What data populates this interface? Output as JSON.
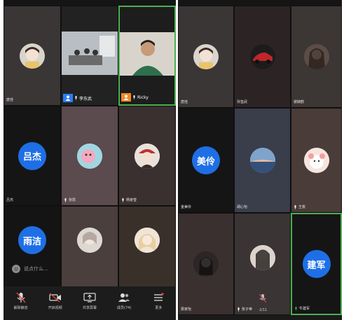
{
  "left_screen": {
    "participants": [
      {
        "name": "唐佳",
        "kind": "photo",
        "bg": "#3a3636",
        "avatar_bg": "#d9d4cc"
      },
      {
        "name": "李东武",
        "kind": "video-host",
        "bg": "#222222",
        "badge_color": "#2d7cf6"
      },
      {
        "name": "Ricky",
        "kind": "video-cohost",
        "bg": "#1d1d1d",
        "badge_color": "#f08a24"
      },
      {
        "name": "吕杰",
        "kind": "text",
        "avatar_text": "吕杰",
        "bg": "#151515"
      },
      {
        "name": "张凯",
        "kind": "photo",
        "bg": "#5b4a4e",
        "avatar_bg": "#e7c7cf"
      },
      {
        "name": "杨家莹",
        "kind": "photo",
        "bg": "#3a3030",
        "avatar_bg": "#d9cfc8"
      },
      {
        "name": "",
        "kind": "text",
        "avatar_text": "雨洁",
        "bg": "#141414"
      },
      {
        "name": "",
        "kind": "photo",
        "bg": "#4a3f3d",
        "avatar_bg": "#e0dcd6"
      },
      {
        "name": "",
        "kind": "photo",
        "bg": "#3a302a",
        "avatar_bg": "#f0e6da"
      }
    ],
    "chat_placeholder": "说点什么...",
    "toolbar": [
      {
        "label": "解除静音",
        "icon": "mic-muted-icon"
      },
      {
        "label": "开启视频",
        "icon": "video-off-icon"
      },
      {
        "label": "共享屏幕",
        "icon": "share-screen-icon"
      },
      {
        "label": "成员(74)",
        "icon": "members-icon"
      },
      {
        "label": "更多",
        "icon": "more-icon"
      }
    ]
  },
  "right_screen": {
    "participants": [
      {
        "name": "唐佳",
        "kind": "photo",
        "bg": "#3a3636",
        "avatar_bg": "#d9d4cc"
      },
      {
        "name": "孙玺武",
        "kind": "photo",
        "bg": "#2c2424",
        "avatar_bg": "#7d2020"
      },
      {
        "name": "谢婧鹤",
        "kind": "photo",
        "bg": "#3c3634",
        "avatar_bg": "#6a5a52"
      },
      {
        "name": "金美伶",
        "kind": "text",
        "avatar_text": "美伶",
        "bg": "#151515"
      },
      {
        "name": "胡心怡",
        "kind": "photo",
        "bg": "#3a3d4a",
        "avatar_bg": "#8fb0d4"
      },
      {
        "name": "王俊",
        "kind": "photo",
        "bg": "#4a3c38",
        "avatar_bg": "#f4d8d0"
      },
      {
        "name": "梁家怡",
        "kind": "photo",
        "bg": "#3a3030",
        "avatar_bg": "#2a2222"
      },
      {
        "name": "张子帝",
        "kind": "photo",
        "bg": "#3a3434",
        "avatar_bg": "#d8d0c8"
      },
      {
        "name": "牛建军",
        "kind": "text",
        "avatar_text": "建军",
        "bg": "#151515"
      }
    ],
    "page_indicator": "2/11"
  },
  "colors": {
    "accent_green": "#4caf50",
    "accent_blue": "#1e6fe6",
    "muted_red": "#e64545"
  }
}
